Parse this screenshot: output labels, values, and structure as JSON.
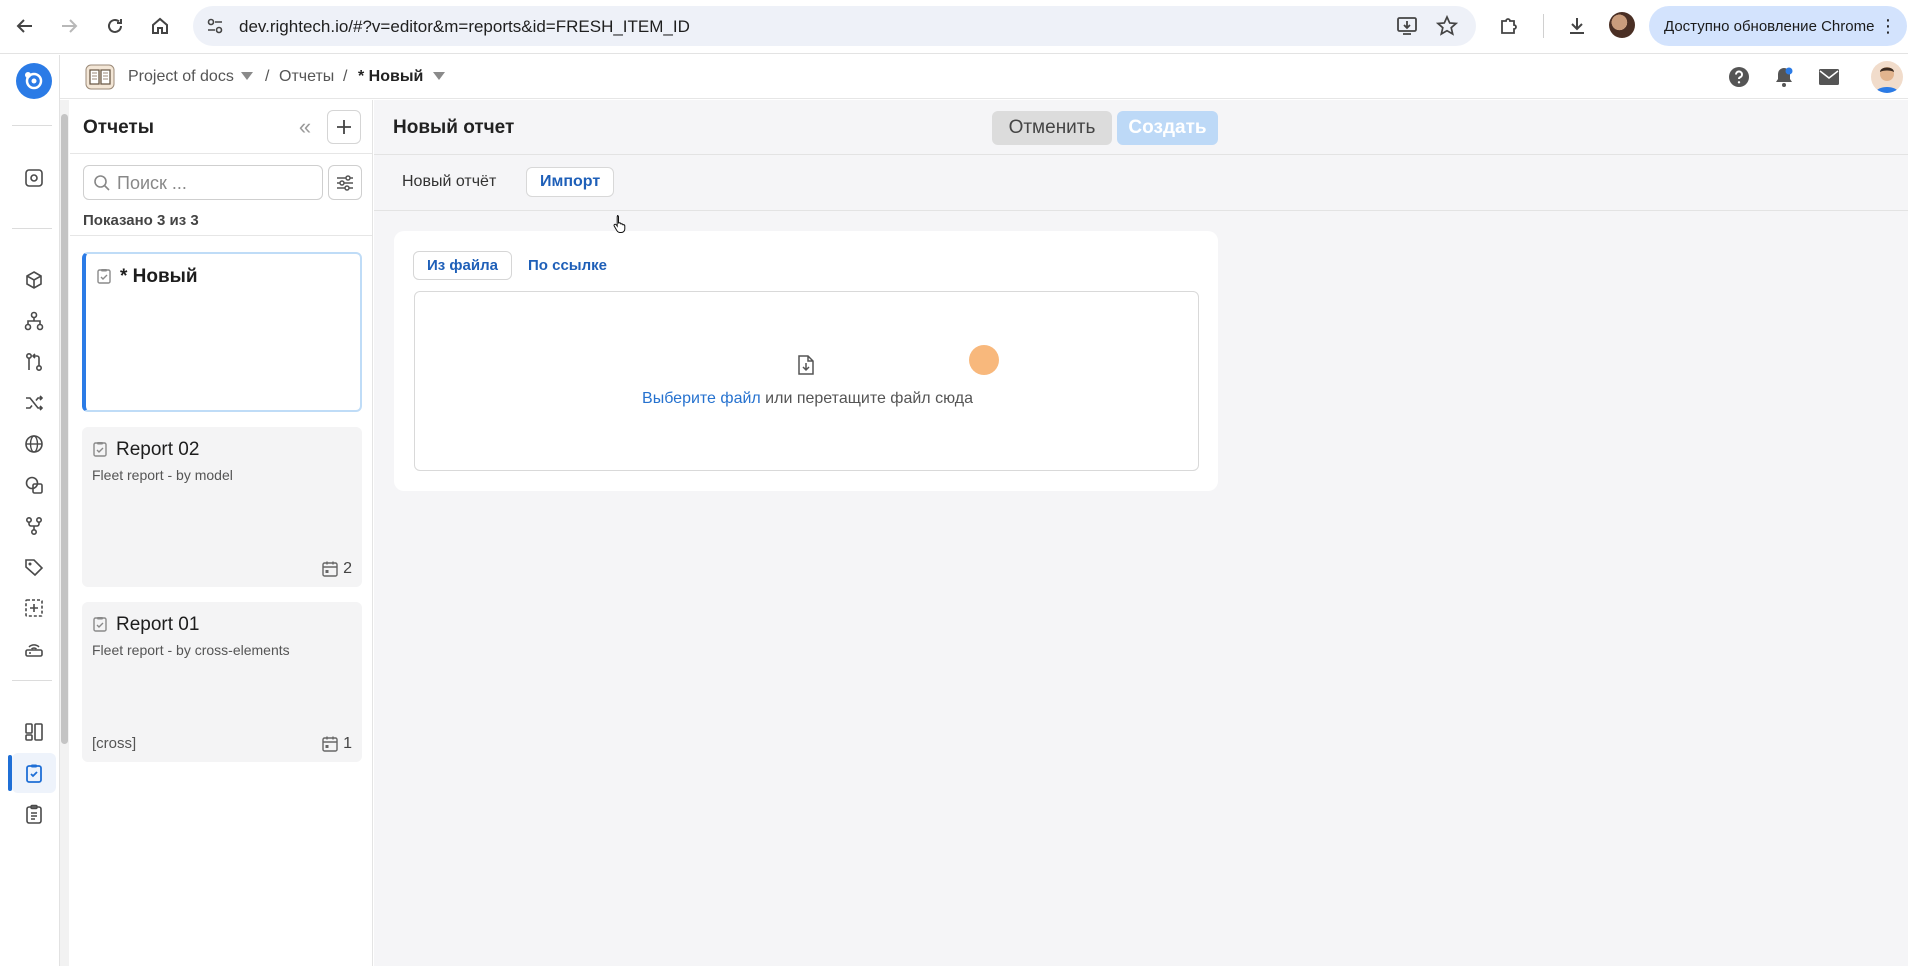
{
  "browser": {
    "url": "dev.rightech.io/#?v=editor&m=reports&id=FRESH_ITEM_ID",
    "update_label": "Доступно обновление Chrome"
  },
  "breadcrumb": {
    "project": "Project of docs",
    "separator": "/",
    "section": "Отчеты",
    "current": "* Новый"
  },
  "sidebar": {
    "items": [
      {
        "icon": "camera-icon"
      },
      {
        "icon": "cube-icon"
      },
      {
        "icon": "hierarchy-icon"
      },
      {
        "icon": "git-compare-icon"
      },
      {
        "icon": "shuffle-icon"
      },
      {
        "icon": "globe-icon"
      },
      {
        "icon": "shapes-icon"
      },
      {
        "icon": "branch-icon"
      },
      {
        "icon": "tag-icon"
      },
      {
        "icon": "frame-plus-icon"
      },
      {
        "icon": "router-icon"
      },
      {
        "icon": "dashboard-icon"
      },
      {
        "icon": "report-icon",
        "active": true
      },
      {
        "icon": "clipboard-icon"
      }
    ]
  },
  "reports_panel": {
    "title": "Отчеты",
    "search_placeholder": "Поиск ...",
    "shown_count": "Показано 3 из 3",
    "items": [
      {
        "title": "* Новый",
        "description": "",
        "tag": "",
        "count": ""
      },
      {
        "title": "Report 02",
        "description": "Fleet report - by model",
        "tag": "",
        "count": "2"
      },
      {
        "title": "Report 01",
        "description": "Fleet report - by cross-elements",
        "tag": "[cross]",
        "count": "1"
      }
    ]
  },
  "main": {
    "title": "Новый отчет",
    "cancel_label": "Отменить",
    "create_label": "Создать",
    "tabs": [
      {
        "label": "Новый отчёт",
        "active": false
      },
      {
        "label": "Импорт",
        "active": true
      }
    ],
    "import": {
      "subtabs": [
        {
          "label": "Из файла",
          "active": true
        },
        {
          "label": "По ссылке",
          "active": false
        }
      ],
      "dropzone_link": "Выберите файл",
      "dropzone_text": " или перетащите файл сюда"
    }
  },
  "colors": {
    "accent": "#2b7be6",
    "link": "#2672cf",
    "create_disabled": "#bdd9f7"
  }
}
